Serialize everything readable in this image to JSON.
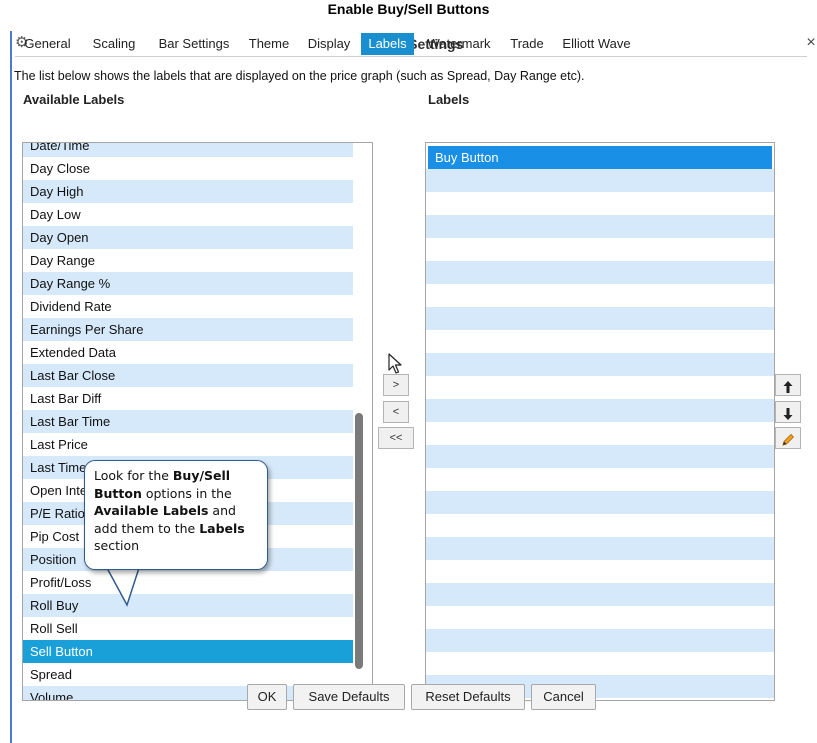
{
  "page_title": "Enable Buy/Sell Buttons",
  "dialog": {
    "title": "Chart Settings",
    "close_icon": "×",
    "gear_icon": "⚙"
  },
  "tabs": [
    {
      "label": "General"
    },
    {
      "label": "Scaling"
    },
    {
      "label": "Bar Settings"
    },
    {
      "label": "Theme"
    },
    {
      "label": "Display"
    },
    {
      "label": "Labels"
    },
    {
      "label": "Watermark"
    },
    {
      "label": "Trade"
    },
    {
      "label": "Elliott Wave"
    }
  ],
  "active_tab": "Labels",
  "description": "The list below shows the labels that are displayed on the price graph (such as Spread, Day Range etc).",
  "available": {
    "header": "Available Labels",
    "items": [
      "Date/Time",
      "Day Close",
      "Day High",
      "Day Low",
      "Day Open",
      "Day Range",
      "Day Range %",
      "Dividend Rate",
      "Earnings Per Share",
      "Extended Data",
      "Last Bar Close",
      "Last Bar Diff",
      "Last Bar Time",
      "Last Price",
      "Last Time",
      "Open Interest",
      "P/E Ratio",
      "Pip Cost",
      "Position",
      "Profit/Loss",
      "Roll Buy",
      "Roll Sell",
      "Sell Button",
      "Spread",
      "Volume"
    ],
    "selected": "Sell Button"
  },
  "labels": {
    "header": "Labels",
    "items": [
      "Buy Button"
    ],
    "selected": "Buy Button"
  },
  "move_buttons": {
    "add": ">",
    "remove": "<",
    "remove_all": "<<"
  },
  "side_buttons": {
    "up": "🡑",
    "down": "🡓",
    "edit": "✎"
  },
  "footer": {
    "ok": "OK",
    "save_defaults": "Save Defaults",
    "reset_defaults": "Reset Defaults",
    "cancel": "Cancel"
  },
  "callout": {
    "t1": "Look for the ",
    "b1": "Buy/Sell Button",
    "t2": " options in the ",
    "b2": "Available Labels",
    "t3": " and add them to the ",
    "b3": "Labels",
    "t4": " section"
  },
  "colors": {
    "accent": "#1a8fd0",
    "row_alt": "#d6e9fa",
    "selected_row": "#1aa0d8",
    "callout_border": "#2e5b8f"
  }
}
